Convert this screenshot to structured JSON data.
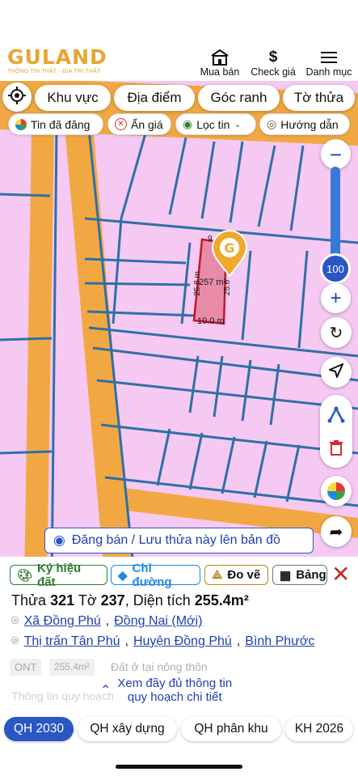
{
  "header": {
    "brand": "GULAND",
    "tagline": "THÔNG TIN THẬT - GIÁ TRỊ THẬT",
    "nav": [
      {
        "label": "Mua bán",
        "icon": "store-icon"
      },
      {
        "label": "Check giá",
        "icon": "dollar-icon"
      },
      {
        "label": "Danh mục",
        "icon": "menu-icon"
      }
    ]
  },
  "filters": {
    "top": [
      "Khu vực",
      "Địa điểm",
      "Góc ranh",
      "Tờ thửa"
    ],
    "chips": [
      "Tin đã đăng",
      "Ẩn giá",
      "Lọc tin",
      "Hướng dẫn"
    ]
  },
  "map": {
    "zoom": "100",
    "zoom_level_fraction": 0.3,
    "plot_labels": {
      "area": "257 m²",
      "left": "25.8 m",
      "right": "25.6",
      "bottom": "10.0 m",
      "top": "9"
    },
    "save_banner": "Đăng bán / Lưu thửa này lên bản đồ",
    "colors": {
      "residential": "#f5c9f2",
      "road": "#f2a842",
      "parcel_line": "#2f6fa8",
      "plot": "#e88ba8",
      "pin": "#f0a92b"
    }
  },
  "panel": {
    "tools": [
      "Ký hiệu đất",
      "Chỉ đường",
      "Đo vẽ",
      "Bảng"
    ],
    "title": {
      "prefix_parcel": "Thửa",
      "parcel": "321",
      "prefix_sheet": "Tờ",
      "sheet": "237",
      "prefix_area": ", Diện tích",
      "area": "255.4m²"
    },
    "address_new": {
      "ward": "Xã Đồng Phú",
      "province": "Đồng Nai (Mới)"
    },
    "address_old": {
      "town": "Thị trấn Tân Phú",
      "district": "Huyện Đồng Phú",
      "province": "Bình Phước"
    },
    "land": {
      "code": "ONT",
      "area": "255.4m²",
      "desc": "Đất ở tại nông thôn"
    },
    "plan_info_label": "Thông tin quy hoạch",
    "see_more": [
      "Xem đầy đủ thông tin",
      "quy hoạch chi tiết"
    ]
  },
  "tabs": [
    "QH 2030",
    "QH xây dựng",
    "QH phân khu",
    "KH 2026"
  ],
  "active_tab": "QH 2030"
}
